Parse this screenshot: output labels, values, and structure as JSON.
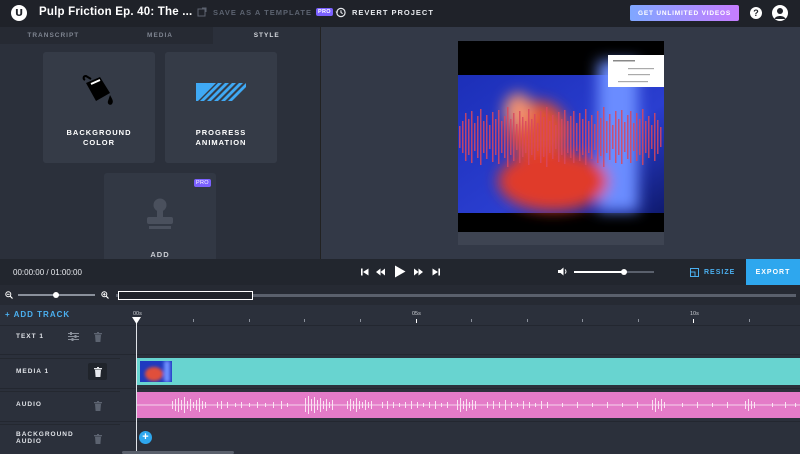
{
  "header": {
    "logo_letter": "U",
    "project_title": "Pulp Friction Ep. 40: The ...",
    "save_template_label": "SAVE AS A TEMPLATE",
    "save_template_badge": "PRO",
    "revert_label": "REVERT PROJECT",
    "unlimited_label": "GET UNLIMITED VIDEOS",
    "help_label": "?"
  },
  "tabs": [
    {
      "label": "TRANSCRIPT",
      "active": false
    },
    {
      "label": "MEDIA",
      "active": false
    },
    {
      "label": "STYLE",
      "active": true
    }
  ],
  "style_options": [
    {
      "label_line1": "BACKGROUND",
      "label_line2": "COLOR",
      "icon": "paint-bucket-icon"
    },
    {
      "label_line1": "PROGRESS",
      "label_line2": "ANIMATION",
      "icon": "progress-stripes-icon"
    },
    {
      "label_line1": "ADD",
      "label_line2": "",
      "icon": "stamp-icon",
      "badge": "PRO"
    }
  ],
  "player": {
    "timecode": "00:00:00 / 01:00:00",
    "volume_level": 0.6,
    "resize_label": "RESIZE",
    "export_label": "EXPORT"
  },
  "zoom": {
    "level": 0.55
  },
  "timeline": {
    "add_track_label": "+ ADD TRACK",
    "ruler_labels": [
      "00s",
      "05s",
      "10s"
    ],
    "tracks": [
      {
        "name_line1": "TEXT 1",
        "name_line2": ""
      },
      {
        "name_line1": "MEDIA 1",
        "name_line2": ""
      },
      {
        "name_line1": "AUDIO",
        "name_line2": ""
      },
      {
        "name_line1": "BACKGROUND",
        "name_line2": "AUDIO"
      }
    ],
    "add_audio_label": "+"
  },
  "colors": {
    "accent": "#2ea7ee",
    "media_track": "#68d4d0",
    "audio_track": "#e47bc8",
    "waveform_overlay": "#d9475f"
  }
}
